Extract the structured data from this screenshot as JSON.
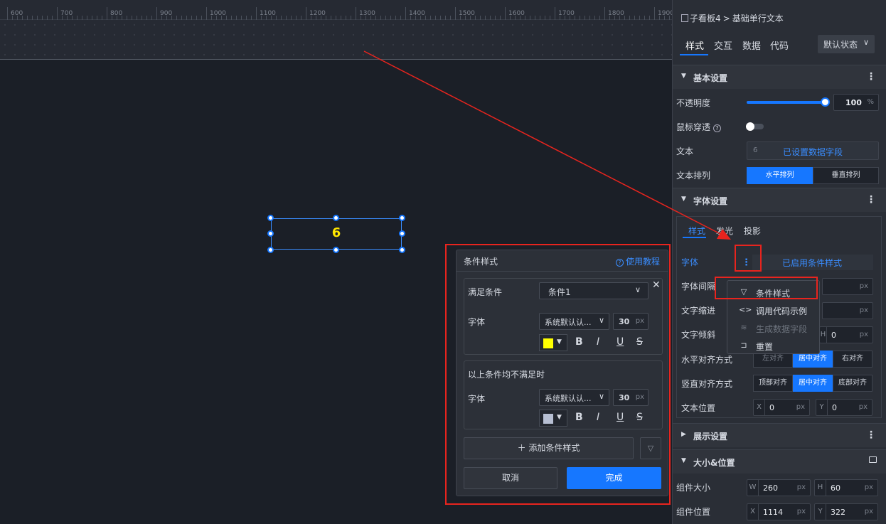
{
  "ruler": {
    "labels": [
      "600",
      "700",
      "800",
      "900",
      "1000",
      "1100",
      "1200",
      "1300",
      "1400",
      "1500",
      "1600",
      "1700",
      "1800",
      "1900"
    ]
  },
  "canvas": {
    "text_value": "6"
  },
  "panel": {
    "breadcrumb_root": "子看板4",
    "breadcrumb_sep": ">",
    "breadcrumb_leaf": "基础单行文本",
    "tabs": [
      "样式",
      "交互",
      "数据",
      "代码"
    ],
    "state_select": "默认状态",
    "basic_section": "基本设置",
    "opacity_label": "不透明度",
    "opacity_value": "100",
    "opacity_unit": "%",
    "opacity_fraction": 1.0,
    "mouse_through_label": "鼠标穿透",
    "text_label": "文本",
    "text_field_prefix": "6",
    "text_field_value": "已设置数据字段",
    "arrange_label": "文本排列",
    "arrange_h": "水平排列",
    "arrange_v": "垂直排列",
    "font_section": "字体设置",
    "font_tabs": [
      "样式",
      "发光",
      "投影"
    ],
    "font_label": "字体",
    "font_status": "已启用条件样式",
    "letter_spacing_label": "字体间隔",
    "indent_label": "文字缩进",
    "skew_label": "文字倾斜",
    "skew_h_prefix": "H",
    "skew_h_value": "0",
    "halign_label": "水平对齐方式",
    "halign_opts": [
      "左对齐",
      "居中对齐",
      "右对齐"
    ],
    "valign_label": "竖直对齐方式",
    "valign_opts": [
      "顶部对齐",
      "居中对齐",
      "底部对齐"
    ],
    "pos_label": "文本位置",
    "pos_x_prefix": "X",
    "pos_x": "0",
    "pos_y_prefix": "Y",
    "pos_y": "0",
    "unit_px": "px",
    "display_section": "展示设置",
    "size_section": "大小&位置",
    "size_label": "组件大小",
    "w_prefix": "W",
    "w": "260",
    "h_prefix": "H",
    "h": "60",
    "position_label": "组件位置",
    "x_prefix": "X",
    "x": "1114",
    "y_prefix": "Y",
    "y": "322"
  },
  "menu": {
    "items": [
      {
        "label": "条件样式",
        "icon": "filter-icon",
        "disabled": false
      },
      {
        "label": "调用代码示例",
        "icon": "code-icon",
        "disabled": false
      },
      {
        "label": "生成数据字段",
        "icon": "database-icon",
        "disabled": true
      },
      {
        "label": "重置",
        "icon": "reset-icon",
        "disabled": false
      }
    ]
  },
  "cond": {
    "title": "条件样式",
    "help": "使用教程",
    "satisfy_label": "满足条件",
    "condition_value": "条件1",
    "font_label": "字体",
    "font_family": "系统默认认...",
    "font_size": "30",
    "font_unit": "px",
    "color1": "#ffff00",
    "else_label": "以上条件均不满足时",
    "font_label2": "字体",
    "font_family2": "系统默认认...",
    "font_size2": "30",
    "font_unit2": "px",
    "color2": "#b7bfd3",
    "bold": "B",
    "italic": "I",
    "underline": "U",
    "strike": "S",
    "add_label": "添加条件样式",
    "cancel": "取消",
    "confirm": "完成"
  }
}
